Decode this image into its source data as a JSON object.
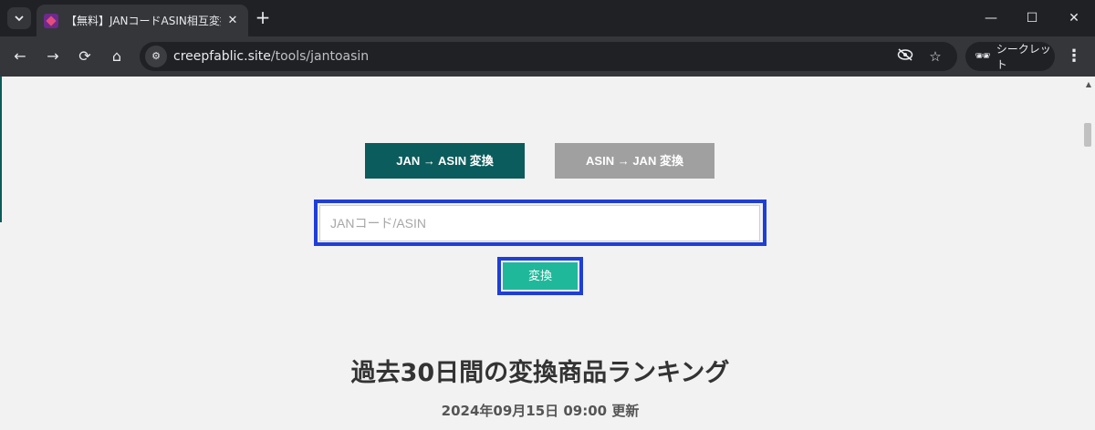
{
  "browser": {
    "tab": {
      "title": "【無料】JANコードASIN相互変換ツール",
      "close_glyph": "✕"
    },
    "new_tab_glyph": "+",
    "window_controls": {
      "minimize": "—",
      "maximize": "☐",
      "close": "✕"
    },
    "nav": {
      "back": "←",
      "forward": "→",
      "reload": "⟳",
      "home": "⌂"
    },
    "url": {
      "host": "creepfablic.site",
      "path": "/tools/jantoasin"
    },
    "incognito_label": "シークレット",
    "icons": [
      "tab-search-icon",
      "site-info-icon",
      "eye-slash-icon",
      "star-icon",
      "incognito-icon",
      "more-vert-icon"
    ]
  },
  "page": {
    "modes": {
      "jan_to_asin": "JAN → ASIN 変換",
      "asin_to_jan": "ASIN → JAN 変換",
      "active": "jan_to_asin"
    },
    "input": {
      "placeholder": "JANコード/ASIN",
      "value": ""
    },
    "convert_label": "変換",
    "ranking_title": "過去30日間の変換商品ランキング",
    "updated_at": "2024年09月15日 09:00 更新"
  },
  "colors": {
    "active_mode": "#0b5c5c",
    "inactive_mode": "#a0a0a0",
    "convert_button": "#20b89a",
    "highlight": "#1f3ed8"
  }
}
